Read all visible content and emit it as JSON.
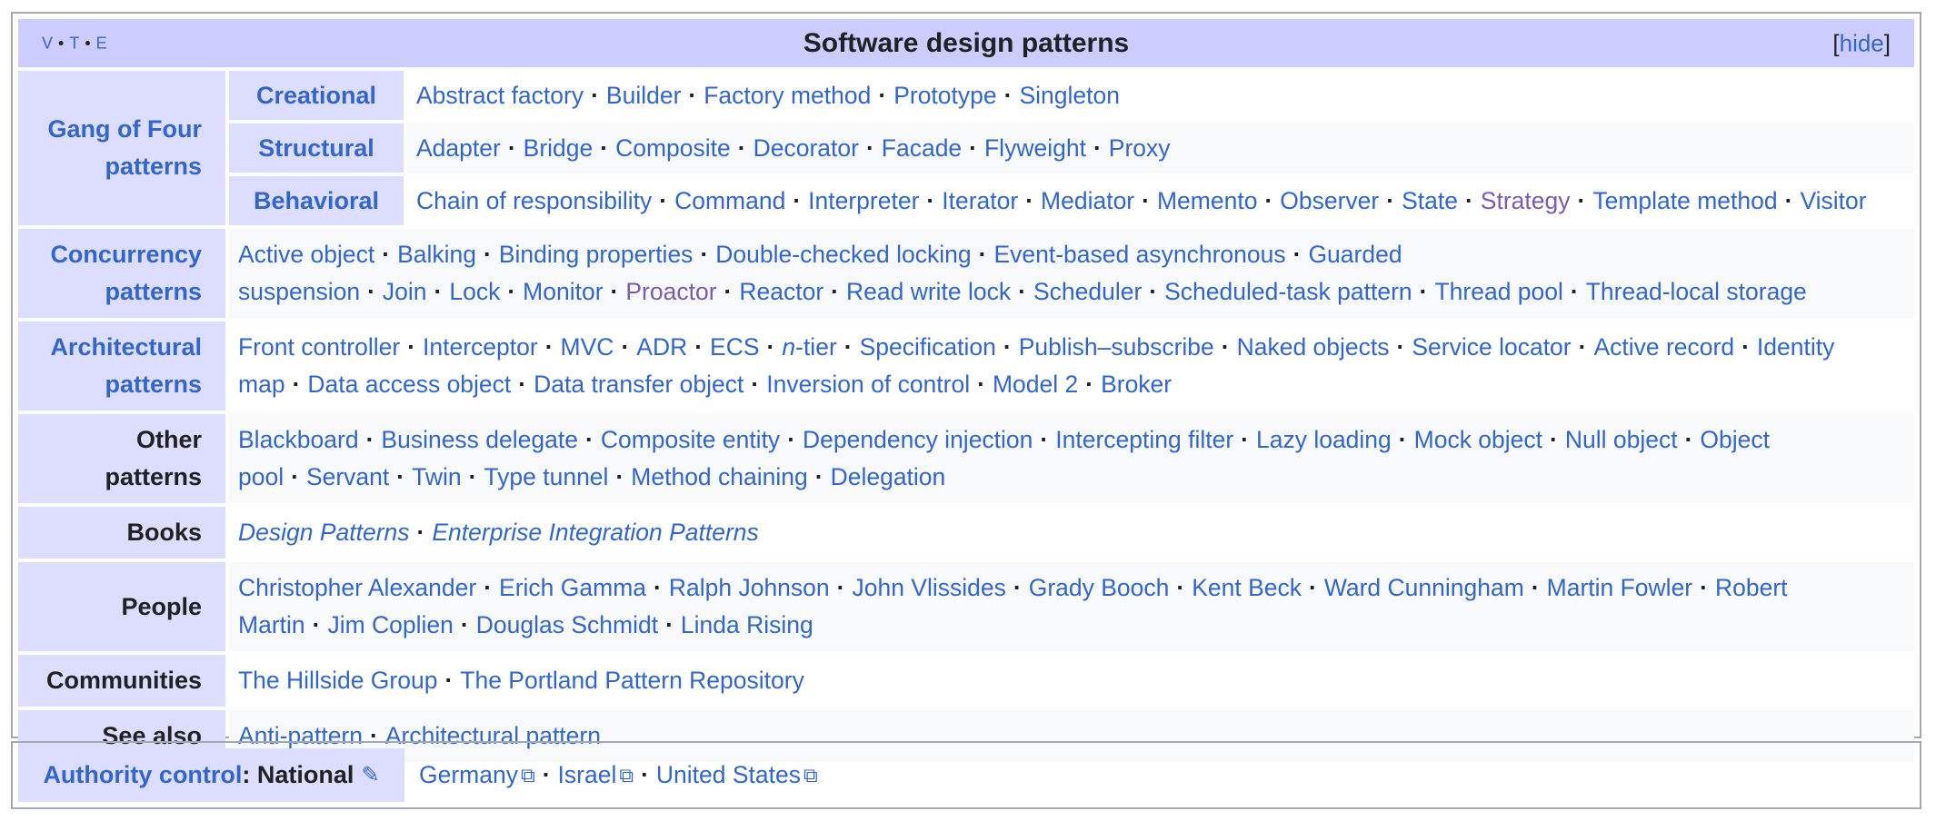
{
  "vte": {
    "v": "V",
    "t": "T",
    "e": "E",
    "dot": "•"
  },
  "title": "Software design patterns",
  "hide": {
    "open": "[",
    "label": "hide",
    "close": "]"
  },
  "sep": "·",
  "gof": {
    "label": "Gang of Four patterns",
    "sub": [
      {
        "label": "Creational",
        "items": [
          "Abstract factory",
          "Builder",
          "Factory method",
          "Prototype",
          "Singleton"
        ]
      },
      {
        "label": "Structural",
        "items": [
          "Adapter",
          "Bridge",
          "Composite",
          "Decorator",
          "Facade",
          "Flyweight",
          "Proxy"
        ]
      },
      {
        "label": "Behavioral",
        "items": [
          "Chain of responsibility",
          "Command",
          "Interpreter",
          "Iterator",
          "Mediator",
          "Memento",
          "Observer",
          "State",
          "Strategy",
          "Template method",
          "Visitor"
        ]
      }
    ]
  },
  "groups": [
    {
      "label": "Concurrency patterns",
      "linked": true,
      "items": [
        "Active object",
        "Balking",
        "Binding properties",
        "Double-checked locking",
        "Event-based asynchronous",
        "Guarded suspension",
        "Join",
        "Lock",
        "Monitor",
        "Proactor",
        "Reactor",
        "Read write lock",
        "Scheduler",
        "Scheduled-task pattern",
        "Thread pool",
        "Thread-local storage"
      ]
    },
    {
      "label": "Architectural patterns",
      "linked": true,
      "items": [
        "Front controller",
        "Interceptor",
        "MVC",
        "ADR",
        "ECS",
        "n-tier",
        "Specification",
        "Publish–subscribe",
        "Naked objects",
        "Service locator",
        "Active record",
        "Identity map",
        "Data access object",
        "Data transfer object",
        "Inversion of control",
        "Model 2",
        "Broker"
      ]
    },
    {
      "label": "Other patterns",
      "linked": false,
      "items": [
        "Blackboard",
        "Business delegate",
        "Composite entity",
        "Dependency injection",
        "Intercepting filter",
        "Lazy loading",
        "Mock object",
        "Null object",
        "Object pool",
        "Servant",
        "Twin",
        "Type tunnel",
        "Method chaining",
        "Delegation"
      ]
    },
    {
      "label": "Books",
      "linked": false,
      "italic": true,
      "items": [
        "Design Patterns",
        "Enterprise Integration Patterns"
      ]
    },
    {
      "label": "People",
      "linked": false,
      "items": [
        "Christopher Alexander",
        "Erich Gamma",
        "Ralph Johnson",
        "John Vlissides",
        "Grady Booch",
        "Kent Beck",
        "Ward Cunningham",
        "Martin Fowler",
        "Robert Martin",
        "Jim Coplien",
        "Douglas Schmidt",
        "Linda Rising"
      ]
    },
    {
      "label": "Communities",
      "linked": false,
      "items": [
        "The Hillside Group",
        "The Portland Pattern Repository"
      ]
    },
    {
      "label": "See also",
      "linked": false,
      "items": [
        "Anti-pattern",
        "Architectural pattern"
      ]
    }
  ],
  "visited": [
    "Strategy",
    "Proactor"
  ],
  "authority": {
    "label_link": "Authority control",
    "label_rest": ": National",
    "items": [
      "Germany",
      "Israel",
      "United States"
    ]
  },
  "colors": {
    "link": "#3366cc",
    "visited": "#795cb2",
    "title_bg": "#ccccff",
    "group_bg": "#ddddff",
    "border": "#a2a9b1"
  },
  "icons": {
    "edit": "pencil-icon",
    "external": "external-link-icon"
  }
}
